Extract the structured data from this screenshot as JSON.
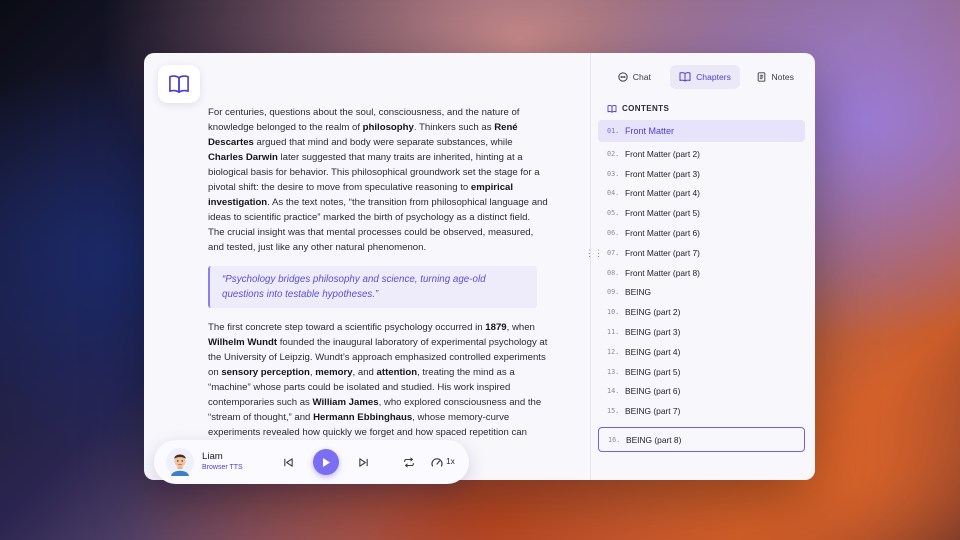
{
  "reader": {
    "p1": [
      {
        "t": "For centuries, questions about the soul, consciousness, and the nature of knowledge belonged to the realm of "
      },
      {
        "t": "philosophy",
        "b": true
      },
      {
        "t": ". Thinkers such as "
      },
      {
        "t": "René Descartes",
        "b": true
      },
      {
        "t": " argued that mind and body were separate substances, while "
      },
      {
        "t": "Charles Darwin",
        "b": true
      },
      {
        "t": " later suggested that many traits are inherited, hinting at a biological basis for behavior. This philosophical groundwork set the stage for a pivotal shift: the desire to move from speculative reasoning to "
      },
      {
        "t": "empirical investigation",
        "b": true
      },
      {
        "t": ". As the text notes, “the transition from philosophical language and ideas to scientific practice” marked the birth of psychology as a distinct field. The crucial insight was that mental processes could be observed, measured, and tested, just like any other natural phenomenon."
      }
    ],
    "quote": "“Psychology bridges philosophy and science, turning age-old questions into testable hypotheses.”",
    "p2": [
      {
        "t": "The first concrete step toward a scientific psychology occurred in "
      },
      {
        "t": "1879",
        "b": true
      },
      {
        "t": ", when "
      },
      {
        "t": "Wilhelm Wundt",
        "b": true
      },
      {
        "t": " founded the inaugural laboratory of experimental psychology at the University of Leipzig. Wundt’s approach emphasized controlled experiments on "
      },
      {
        "t": "sensory perception",
        "b": true
      },
      {
        "t": ", "
      },
      {
        "t": "memory",
        "b": true
      },
      {
        "t": ", and "
      },
      {
        "t": "attention",
        "b": true
      },
      {
        "t": ", treating the mind as a “machine” whose parts could be isolated and studied. His work inspired contemporaries such as "
      },
      {
        "t": "William James",
        "b": true
      },
      {
        "t": ", who explored consciousness and the “stream of thought,” and "
      },
      {
        "t": "Hermann Ebbinghaus",
        "b": true
      },
      {
        "t": ", whose memory-curve experiments revealed how quickly we forget and how spaced repetition can improve retention."
      }
    ]
  },
  "tabs": {
    "chat": "Chat",
    "chapters": "Chapters",
    "notes": "Notes",
    "active": "chapters"
  },
  "contents_heading": "CONTENTS",
  "chapters": [
    {
      "num": "01.",
      "title": "Front Matter",
      "state": "active"
    },
    {
      "num": "02.",
      "title": "Front Matter (part 2)"
    },
    {
      "num": "03.",
      "title": "Front Matter (part 3)"
    },
    {
      "num": "04.",
      "title": "Front Matter (part 4)"
    },
    {
      "num": "05.",
      "title": "Front Matter (part 5)"
    },
    {
      "num": "06.",
      "title": "Front Matter (part 6)"
    },
    {
      "num": "07.",
      "title": "Front Matter (part 7)"
    },
    {
      "num": "08.",
      "title": "Front Matter (part 8)"
    },
    {
      "num": "09.",
      "title": "BEING"
    },
    {
      "num": "10.",
      "title": "BEING (part 2)"
    },
    {
      "num": "11.",
      "title": "BEING (part 3)"
    },
    {
      "num": "12.",
      "title": "BEING (part 4)"
    },
    {
      "num": "13.",
      "title": "BEING (part 5)"
    },
    {
      "num": "14.",
      "title": "BEING (part 6)"
    },
    {
      "num": "15.",
      "title": "BEING (part 7)"
    },
    {
      "num": "16.",
      "title": "BEING (part 8)",
      "state": "boxed"
    }
  ],
  "player": {
    "voice_name": "Liam",
    "voice_source": "Browser TTS",
    "speed": "1x"
  },
  "colors": {
    "accent": "#7b6ef2",
    "accent_text": "#4b3fd1"
  }
}
